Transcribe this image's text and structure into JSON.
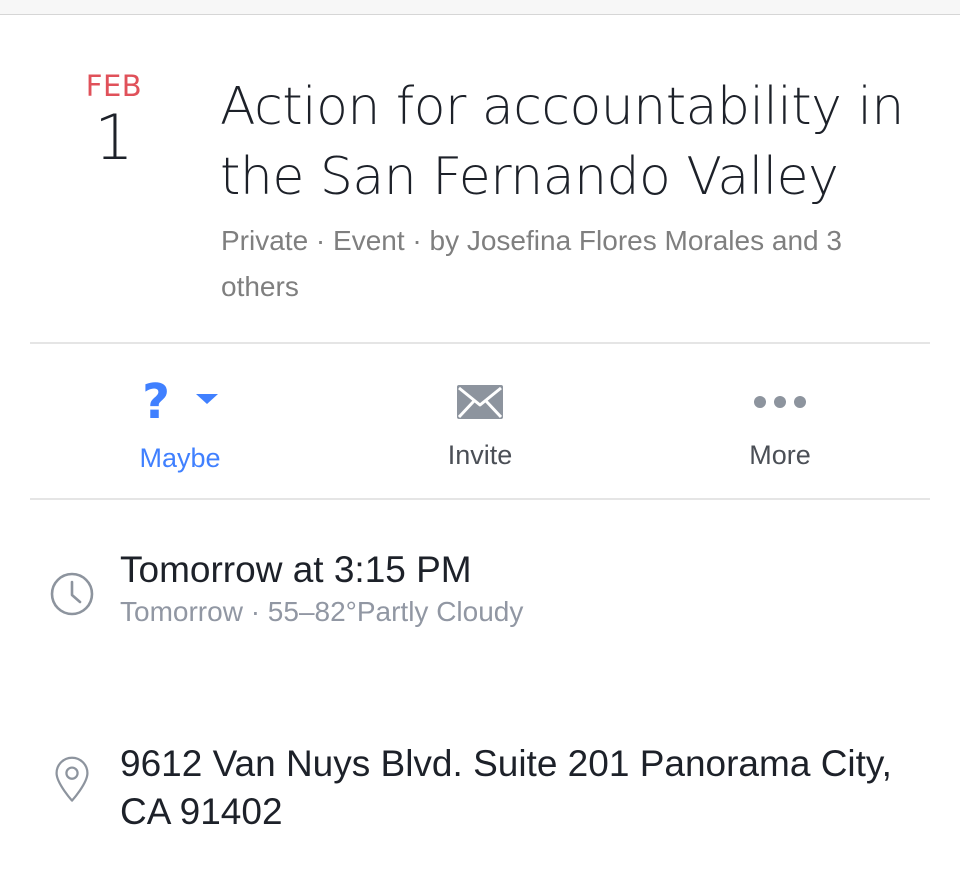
{
  "event": {
    "date_month": "FEB",
    "date_day": "1",
    "title": "Action for accountability in the San Fernando Valley",
    "meta": "Private · Event · by Josefina Flores Morales and 3 others"
  },
  "actions": {
    "maybe": {
      "label": "Maybe",
      "icon": "question-mark-icon",
      "color": "#4080ff"
    },
    "invite": {
      "label": "Invite",
      "icon": "envelope-icon"
    },
    "more": {
      "label": "More",
      "icon": "more-dots-icon"
    }
  },
  "details": {
    "time_main": "Tomorrow at 3:15 PM",
    "time_sub": "Tomorrow · 55–82°Partly Cloudy",
    "address": "9612 Van Nuys Blvd. Suite 201 Panorama City, CA 91402"
  },
  "colors": {
    "date_month": "#e0515a",
    "accent": "#4080ff",
    "secondary_text": "#7f7f7f"
  }
}
